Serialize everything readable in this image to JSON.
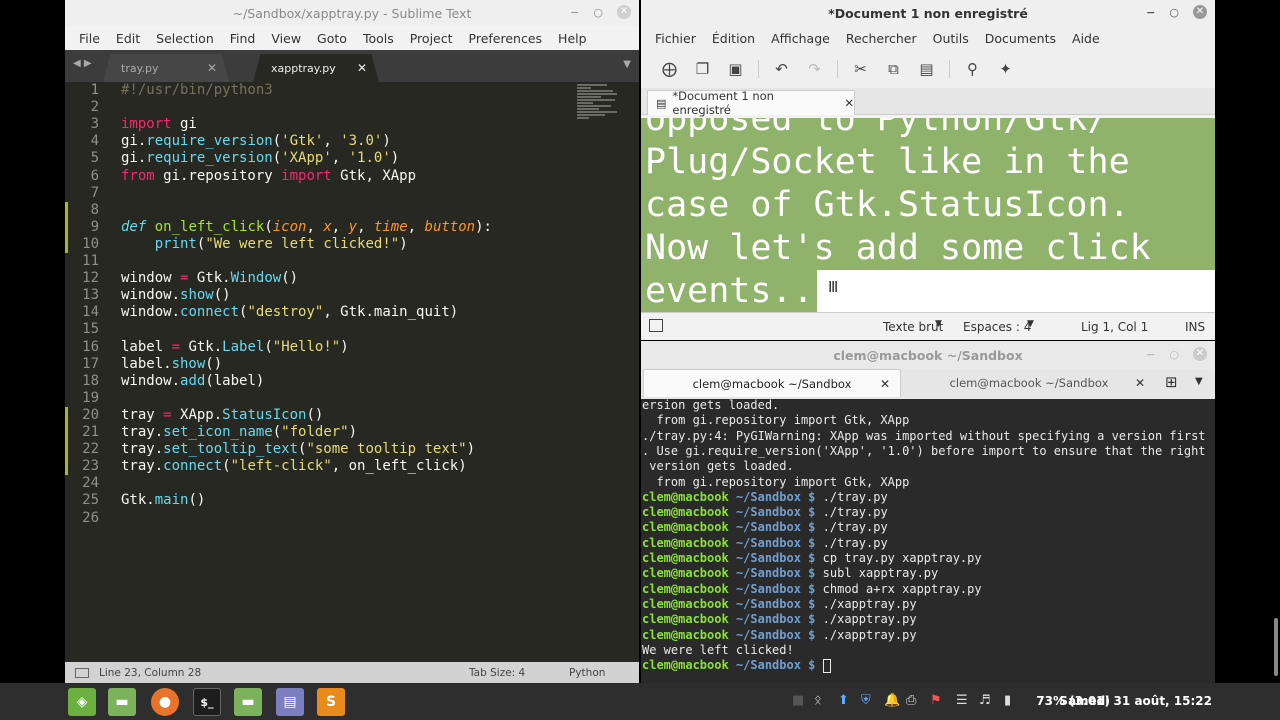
{
  "sublime": {
    "title": "~/Sandbox/xapptray.py - Sublime Text",
    "menu": [
      "File",
      "Edit",
      "Selection",
      "Find",
      "View",
      "Goto",
      "Tools",
      "Project",
      "Preferences",
      "Help"
    ],
    "tabs": [
      {
        "label": "tray.py",
        "active": false
      },
      {
        "label": "xapptray.py",
        "active": true
      }
    ],
    "status": {
      "position": "Line 23, Column 28",
      "tab_size": "Tab Size: 4",
      "syntax": "Python"
    },
    "lines": [
      {
        "n": "1",
        "t": "#!/usr/bin/python3"
      },
      {
        "n": "2",
        "t": ""
      },
      {
        "n": "3",
        "t": "import gi"
      },
      {
        "n": "4",
        "t": "gi.require_version('Gtk', '3.0')"
      },
      {
        "n": "5",
        "t": "gi.require_version('XApp', '1.0')"
      },
      {
        "n": "6",
        "t": "from gi.repository import Gtk, XApp"
      },
      {
        "n": "7",
        "t": ""
      },
      {
        "n": "8",
        "t": ""
      },
      {
        "n": "9",
        "t": "def on_left_click(icon, x, y, time, button):"
      },
      {
        "n": "10",
        "t": "    print(\"We were left clicked!\")"
      },
      {
        "n": "11",
        "t": ""
      },
      {
        "n": "12",
        "t": "window = Gtk.Window()"
      },
      {
        "n": "13",
        "t": "window.show()"
      },
      {
        "n": "14",
        "t": "window.connect(\"destroy\", Gtk.main_quit)"
      },
      {
        "n": "15",
        "t": ""
      },
      {
        "n": "16",
        "t": "label = Gtk.Label(\"Hello!\")"
      },
      {
        "n": "17",
        "t": "label.show()"
      },
      {
        "n": "18",
        "t": "window.add(label)"
      },
      {
        "n": "19",
        "t": ""
      },
      {
        "n": "20",
        "t": "tray = XApp.StatusIcon()"
      },
      {
        "n": "21",
        "t": "tray.set_icon_name(\"folder\")"
      },
      {
        "n": "22",
        "t": "tray.set_tooltip_text(\"some tooltip text\")"
      },
      {
        "n": "23",
        "t": "tray.connect(\"left-click\", on_left_click)"
      },
      {
        "n": "24",
        "t": ""
      },
      {
        "n": "25",
        "t": "Gtk.main()"
      },
      {
        "n": "26",
        "t": ""
      }
    ]
  },
  "gedit": {
    "title": "*Document 1 non enregistré",
    "menu": [
      "Fichier",
      "Édition",
      "Affichage",
      "Rechercher",
      "Outils",
      "Documents",
      "Aide"
    ],
    "tab_label": "*Document 1 non enregistré",
    "text_lines": [
      "opposed to Python/Gtk/",
      "Plug/Socket like in the",
      "case of Gtk.StatusIcon.",
      "Now let's add some click",
      "events.."
    ],
    "status": {
      "syntax": "Texte brut",
      "spaces": "Espaces : 4",
      "position": "Lig 1, Col 1",
      "mode": "INS"
    }
  },
  "terminal": {
    "title": "clem@macbook ~/Sandbox",
    "tabs": [
      "clem@macbook ~/Sandbox",
      "clem@macbook ~/Sandbox"
    ],
    "prompt_user": "clem@macbook",
    "prompt_path": "~/Sandbox $",
    "output": [
      {
        "kind": "out",
        "text": "ersion gets loaded."
      },
      {
        "kind": "out",
        "text": "  from gi.repository import Gtk, XApp"
      },
      {
        "kind": "out",
        "text": "./tray.py:4: PyGIWarning: XApp was imported without specifying a version first"
      },
      {
        "kind": "out",
        "text": ". Use gi.require_version('XApp', '1.0') before import to ensure that the right"
      },
      {
        "kind": "out",
        "text": " version gets loaded."
      },
      {
        "kind": "out",
        "text": "  from gi.repository import Gtk, XApp"
      },
      {
        "kind": "cmd",
        "text": "./tray.py"
      },
      {
        "kind": "cmd",
        "text": "./tray.py"
      },
      {
        "kind": "cmd",
        "text": "./tray.py"
      },
      {
        "kind": "cmd",
        "text": "./tray.py"
      },
      {
        "kind": "cmd",
        "text": "cp tray.py xapptray.py"
      },
      {
        "kind": "cmd",
        "text": "subl xapptray.py"
      },
      {
        "kind": "cmd",
        "text": "chmod a+rx xapptray.py"
      },
      {
        "kind": "cmd",
        "text": "./xapptray.py"
      },
      {
        "kind": "cmd",
        "text": "./xapptray.py"
      },
      {
        "kind": "cmd",
        "text": "./xapptray.py"
      },
      {
        "kind": "out",
        "text": "We were left clicked!"
      },
      {
        "kind": "cmd",
        "text": ""
      }
    ]
  },
  "panel": {
    "battery": "73% (3:01)",
    "clock": "Samedi 31 août, 15:22"
  },
  "colors": {
    "selection": "#8fb36b",
    "editor_bg": "#272822",
    "prompt_user": "#8ae234",
    "prompt_path": "#729fcf"
  }
}
